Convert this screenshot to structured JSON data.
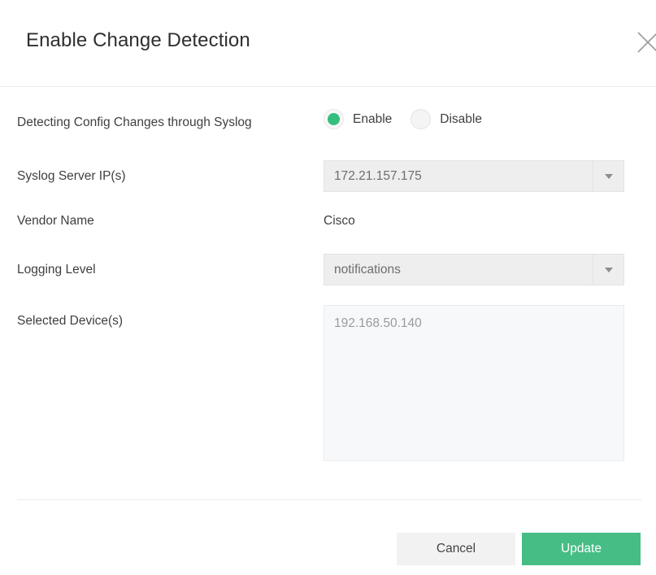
{
  "dialog": {
    "title": "Enable Change Detection",
    "close_icon": "close-icon"
  },
  "form": {
    "detection": {
      "label": "Detecting Config Changes through Syslog",
      "selected": "Enable",
      "options": [
        {
          "label": "Enable",
          "checked": true
        },
        {
          "label": "Disable",
          "checked": false
        }
      ]
    },
    "syslog_server": {
      "label": "Syslog Server IP(s)",
      "value": "172.21.157.175",
      "dropdown_icon": "chevron-down-icon"
    },
    "vendor": {
      "label": "Vendor Name",
      "value": "Cisco"
    },
    "logging_level": {
      "label": "Logging Level",
      "value": "notifications",
      "dropdown_icon": "chevron-down-icon"
    },
    "selected_devices": {
      "label": "Selected Device(s)",
      "value": "192.168.50.140"
    }
  },
  "footer": {
    "cancel_label": "Cancel",
    "update_label": "Update"
  },
  "colors": {
    "accent_green": "#45bd85",
    "radio_green": "#35bd7e",
    "field_gray": "#eeeeee",
    "textarea_gray": "#f7f8fa",
    "cancel_gray": "#f2f2f2"
  }
}
